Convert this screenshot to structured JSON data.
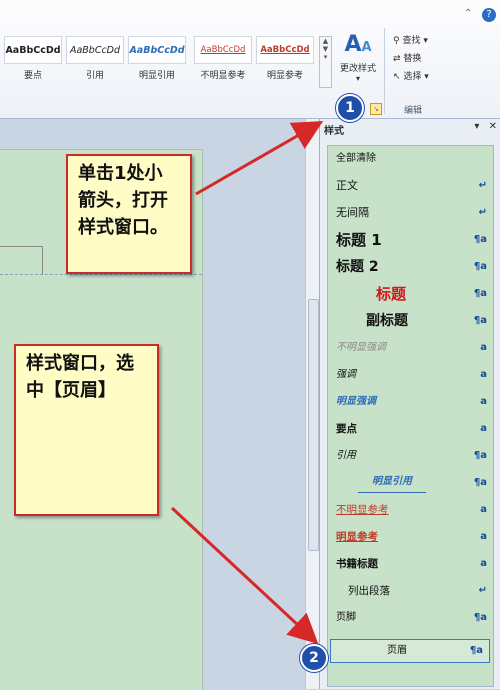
{
  "ribbon": {
    "gallery": [
      {
        "sample": "AaBbCcDd",
        "name": "要点"
      },
      {
        "sample": "AaBbCcDd",
        "name": "引用"
      },
      {
        "sample": "AaBbCcDd",
        "name": "明显引用"
      },
      {
        "sample": "AaBbCcDd",
        "name": "不明显参考"
      },
      {
        "sample": "AaBbCcDd",
        "name": "明显参考"
      }
    ],
    "change_style": "更改样式",
    "edit": {
      "find": "查找",
      "replace": "替换",
      "select": "选择"
    },
    "edit_group": "编辑",
    "styles_launcher_icon": "dialog-launcher-icon",
    "colors": {
      "accent": "#1f4fa8",
      "callout_border": "#cc2a2a",
      "callout_fill": "#fffcc5",
      "page_green": "#c7e2c8"
    }
  },
  "pane": {
    "title": "样式",
    "items": [
      {
        "label": "全部清除",
        "mark": ""
      },
      {
        "label": "正文",
        "mark": "↵"
      },
      {
        "label": "无间隔",
        "mark": "↵"
      },
      {
        "label": "标题 1",
        "mark": "¶a"
      },
      {
        "label": "标题 2",
        "mark": "¶a"
      },
      {
        "label": "标题",
        "mark": "¶a"
      },
      {
        "label": "副标题",
        "mark": "¶a"
      },
      {
        "label": "不明显强调",
        "mark": "a"
      },
      {
        "label": "强调",
        "mark": "a"
      },
      {
        "label": "明显强调",
        "mark": "a"
      },
      {
        "label": "要点",
        "mark": "a"
      },
      {
        "label": "引用",
        "mark": "¶a"
      },
      {
        "label": "明显引用",
        "mark": "¶a"
      },
      {
        "label": "不明显参考",
        "mark": "a"
      },
      {
        "label": "明显参考",
        "mark": "a"
      },
      {
        "label": "书籍标题",
        "mark": "a"
      },
      {
        "label": "列出段落",
        "mark": "↵"
      },
      {
        "label": "页脚",
        "mark": "¶a"
      },
      {
        "label": "页眉",
        "mark": "¶a"
      }
    ]
  },
  "callouts": {
    "step1": "单击1处小箭头，打开样式窗口。",
    "step2": "样式窗口，选中【页眉】"
  },
  "badges": {
    "one": "1",
    "two": "2"
  }
}
